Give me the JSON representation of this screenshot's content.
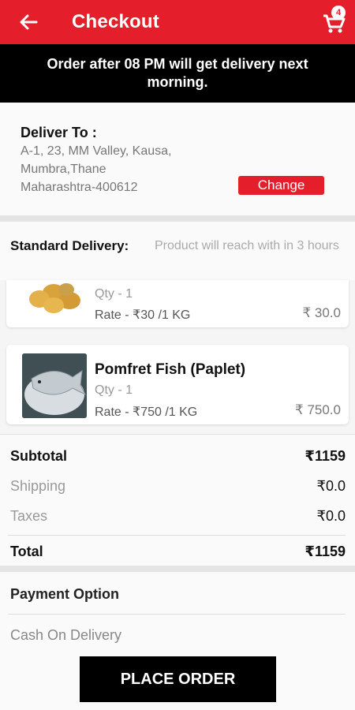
{
  "header": {
    "title": "Checkout",
    "cart_count": "4",
    "bar_color": "#e41e2b",
    "back_icon": "arrow-left-icon",
    "cart_icon": "cart-icon"
  },
  "notice": "Order after 08 PM will get delivery next morning.",
  "address": {
    "label": "Deliver To :",
    "line1": "A-1, 23, MM Valley, Kausa,",
    "line2": "Mumbra,Thane",
    "line3": "Maharashtra-400612",
    "change_label": "Change"
  },
  "delivery": {
    "label": "Standard Delivery:",
    "note": "Product will reach with in 3 hours"
  },
  "cart_items": [
    {
      "name": "",
      "qty": "Qty - 1",
      "rate": "Rate - ₹30 /1 KG",
      "price": "₹ 30.0",
      "image_icon": "potatoes-image"
    },
    {
      "name": "Pomfret Fish (Paplet)",
      "qty": "Qty - 1",
      "rate": "Rate - ₹750 /1 KG",
      "price": "₹ 750.0",
      "image_icon": "pomfret-fish-image"
    }
  ],
  "summary": {
    "subtotal_label": "Subtotal",
    "subtotal_value": "₹1159",
    "shipping_label": "Shipping",
    "shipping_value": "₹0.0",
    "taxes_label": "Taxes",
    "taxes_value": "₹0.0",
    "total_label": "Total",
    "total_value": "₹1159"
  },
  "payment": {
    "title": "Payment Option",
    "option": "Cash On Delivery",
    "place_order_label": "PLACE ORDER"
  }
}
